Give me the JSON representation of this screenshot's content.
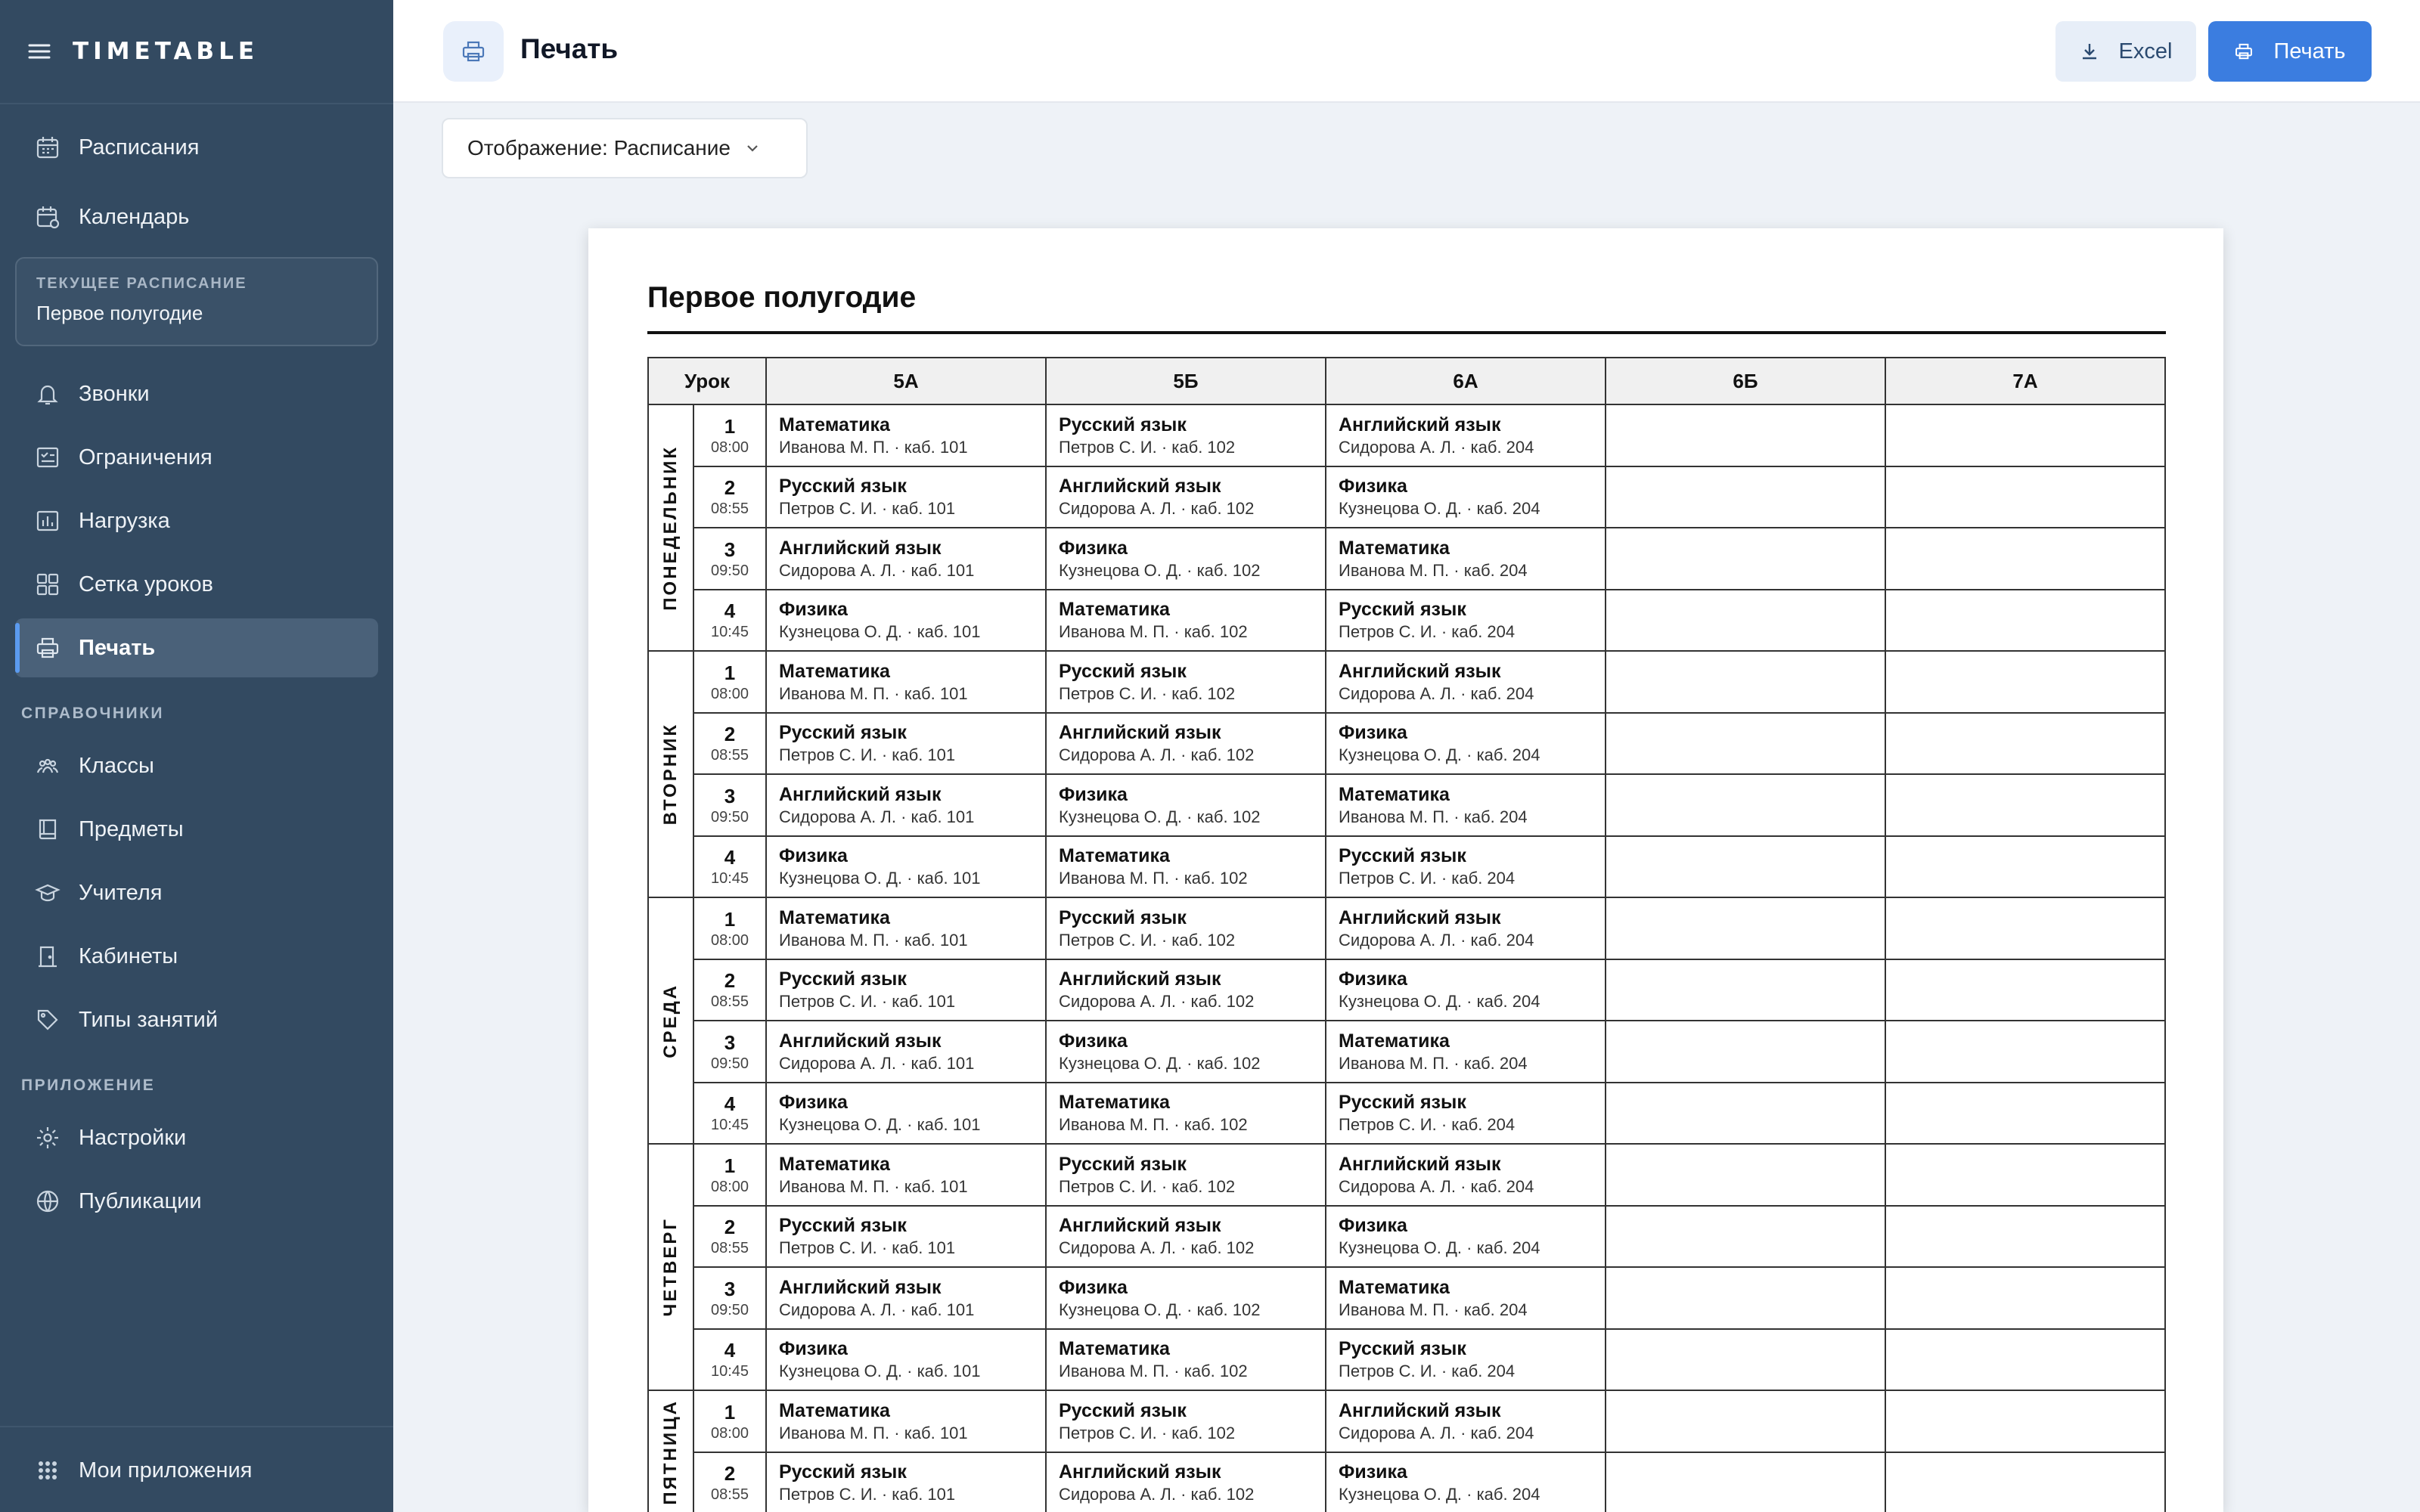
{
  "app": {
    "brand": "TIMETABLE"
  },
  "sidebar": {
    "items": [
      {
        "label": "Расписания",
        "icon": "calendar-icon"
      },
      {
        "label": "Календарь",
        "icon": "calendar-clock-icon"
      }
    ],
    "current": {
      "label": "ТЕКУЩЕЕ РАСПИСАНИЕ",
      "value": "Первое полугодие"
    },
    "items2": [
      {
        "label": "Звонки",
        "icon": "bell-icon"
      },
      {
        "label": "Ограничения",
        "icon": "checklist-icon"
      },
      {
        "label": "Нагрузка",
        "icon": "bar-chart-icon"
      },
      {
        "label": "Сетка уроков",
        "icon": "grid-icon"
      },
      {
        "label": "Печать",
        "icon": "printer-icon",
        "active": true
      }
    ],
    "section_refs": "СПРАВОЧНИКИ",
    "refs": [
      {
        "label": "Классы",
        "icon": "users-icon"
      },
      {
        "label": "Предметы",
        "icon": "book-icon"
      },
      {
        "label": "Учителя",
        "icon": "graduation-cap-icon"
      },
      {
        "label": "Кабинеты",
        "icon": "door-icon"
      },
      {
        "label": "Типы занятий",
        "icon": "tag-icon"
      }
    ],
    "section_app": "ПРИЛОЖЕНИЕ",
    "app_items": [
      {
        "label": "Настройки",
        "icon": "gear-icon"
      },
      {
        "label": "Публикации",
        "icon": "globe-icon"
      }
    ],
    "footer": {
      "label": "Мои приложения",
      "icon": "apps-grid-icon"
    }
  },
  "header": {
    "title": "Печать",
    "excel_label": "Excel",
    "print_label": "Печать"
  },
  "toolbar": {
    "view_select": "Отображение: Расписание"
  },
  "document": {
    "title": "Первое полугодие",
    "columns": [
      "Урок",
      "5А",
      "5Б",
      "6А",
      "6Б",
      "7А"
    ],
    "days": [
      "ПОНЕДЕЛЬНИК",
      "ВТОРНИК",
      "СРЕДА",
      "ЧЕТВЕРГ",
      "ПЯТНИЦА"
    ],
    "lessons": [
      {
        "n": "1",
        "time": "08:00",
        "cells": [
          {
            "subject": "Математика",
            "detail": "Иванова М. П. · каб. 101"
          },
          {
            "subject": "Русский язык",
            "detail": "Петров С. И. · каб. 102"
          },
          {
            "subject": "Английский язык",
            "detail": "Сидорова А. Л. · каб. 204"
          },
          null,
          null
        ]
      },
      {
        "n": "2",
        "time": "08:55",
        "cells": [
          {
            "subject": "Русский язык",
            "detail": "Петров С. И. · каб. 101"
          },
          {
            "subject": "Английский язык",
            "detail": "Сидорова А. Л. · каб. 102"
          },
          {
            "subject": "Физика",
            "detail": "Кузнецова О. Д. · каб. 204"
          },
          null,
          null
        ]
      },
      {
        "n": "3",
        "time": "09:50",
        "cells": [
          {
            "subject": "Английский язык",
            "detail": "Сидорова А. Л. · каб. 101"
          },
          {
            "subject": "Физика",
            "detail": "Кузнецова О. Д. · каб. 102"
          },
          {
            "subject": "Математика",
            "detail": "Иванова М. П. · каб. 204"
          },
          null,
          null
        ]
      },
      {
        "n": "4",
        "time": "10:45",
        "cells": [
          {
            "subject": "Физика",
            "detail": "Кузнецова О. Д. · каб. 101"
          },
          {
            "subject": "Математика",
            "detail": "Иванова М. П. · каб. 102"
          },
          {
            "subject": "Русский язык",
            "detail": "Петров С. И. · каб. 204"
          },
          null,
          null
        ]
      }
    ],
    "lessons_per_day_visible": [
      4,
      4,
      4,
      4,
      2
    ]
  }
}
